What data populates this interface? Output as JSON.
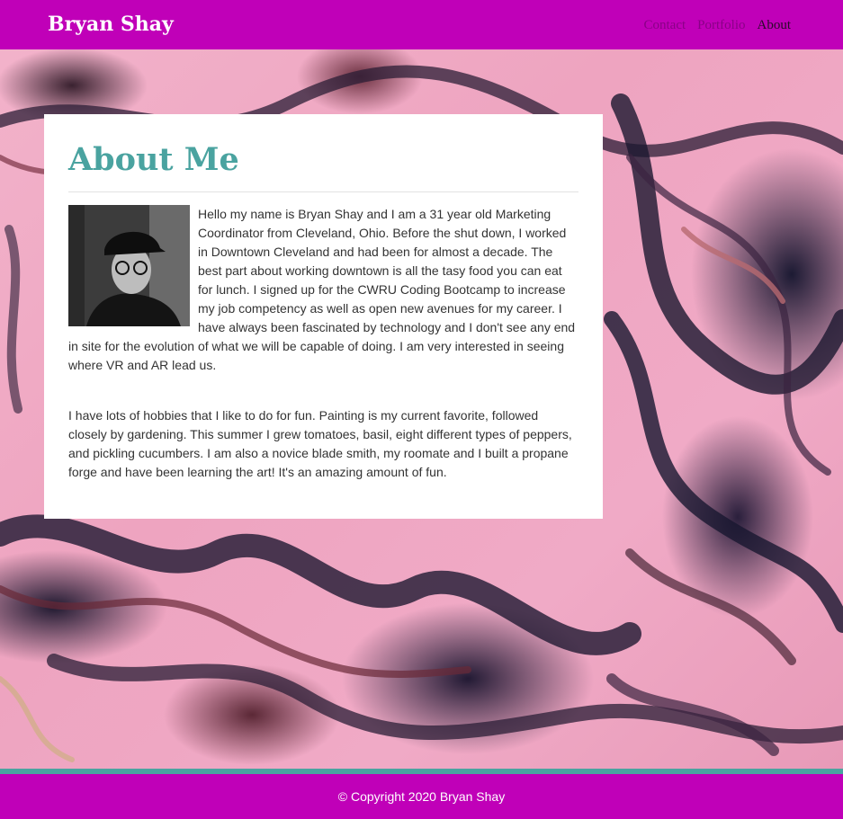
{
  "header": {
    "brand": "Bryan Shay",
    "nav": [
      "Contact",
      "Portfolio",
      "About"
    ]
  },
  "about": {
    "title": "About Me",
    "paragraph1": "Hello my name is Bryan Shay and I am a 31 year old Marketing Coordinator from Cleveland, Ohio. Before the shut down, I worked in Downtown Cleveland and had been for almost a decade. The best part about working downtown is all the tasy food you can eat for lunch. I signed up for the CWRU Coding Bootcamp to increase my job competency as well as open new avenues for my career. I have always been fascinated by technology and I don't see any end in site for the evolution of what we will be capable of doing. I am very interested in seeing where VR and AR lead us.",
    "paragraph2": "I have lots of hobbies that I like to do for fun. Painting is my current favorite, followed closely by gardening. This summer I grew tomatoes, basil, eight different types of peppers, and pickling cucumbers. I am also a novice blade smith, my roomate and I built a propane forge and have been learning the art! It's an amazing amount of fun."
  },
  "footer": {
    "copyright": "© Copyright 2020 Bryan Shay"
  },
  "colors": {
    "header_bg": "#c000b8",
    "accent": "#4aa3a0",
    "nav_link": "#8a0087",
    "background_pink": "#f0a8c4"
  }
}
